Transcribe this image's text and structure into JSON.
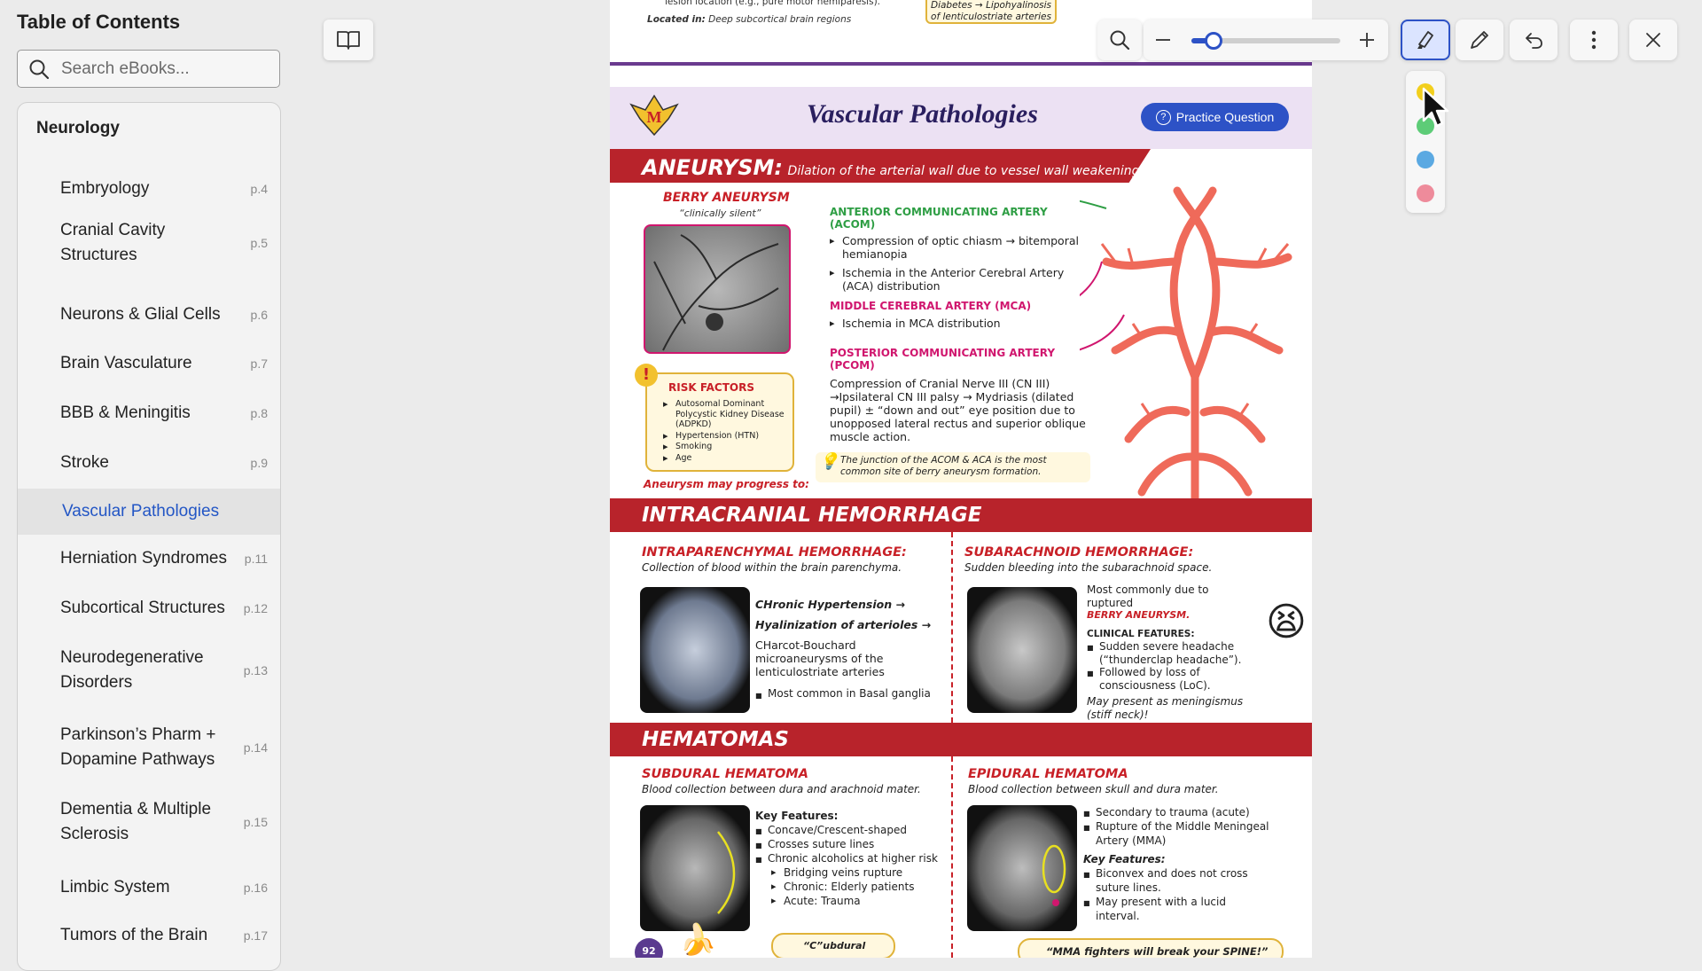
{
  "sidebar": {
    "title": "Table of Contents",
    "search_placeholder": "Search eBooks...",
    "section": "Neurology",
    "items": [
      {
        "label": "Embryology",
        "page": "p.4"
      },
      {
        "label": "Cranial Cavity Structures",
        "page": "p.5"
      },
      {
        "label": "Neurons & Glial Cells",
        "page": "p.6"
      },
      {
        "label": "Brain Vasculature",
        "page": "p.7"
      },
      {
        "label": "BBB & Meningitis",
        "page": "p.8"
      },
      {
        "label": "Stroke",
        "page": "p.9"
      },
      {
        "label": "Vascular Pathologies",
        "page": ""
      },
      {
        "label": "Herniation Syndromes",
        "page": "p.11"
      },
      {
        "label": "Subcortical Structures",
        "page": "p.12"
      },
      {
        "label": "Neurodegenerative Disorders",
        "page": "p.13"
      },
      {
        "label": "Parkinson’s Pharm + Dopamine Pathways",
        "page": "p.14"
      },
      {
        "label": "Dementia & Multiple Sclerosis",
        "page": "p.15"
      },
      {
        "label": "Limbic System",
        "page": "p.16"
      },
      {
        "label": "Tumors of the Brain",
        "page": "p.17"
      }
    ]
  },
  "toolbar": {
    "icons": [
      "search-icon",
      "zoom-out-icon",
      "zoom-slider",
      "zoom-in-icon",
      "highlighter-icon",
      "pencil-icon",
      "undo-icon",
      "more-icon",
      "close-icon"
    ],
    "zoom_level": 0.15,
    "highlight_colors": [
      "#f2cf1d",
      "#5dcc77",
      "#5ba9e2",
      "#ee8b9b"
    ]
  },
  "document": {
    "top_partial": "lesion location (e.g., pure motor hemiparesis).",
    "located_in_label": "Located in:",
    "located_in_text": "Deep subcortical brain regions",
    "top_box_line1": "Diabetes → Lipohyalinosis",
    "top_box_line2": "of lenticulostriate arteries",
    "title": "Vascular Pathologies",
    "practice_label": "Practice Question",
    "aneurysm": {
      "heading": "ANEURYSM:",
      "definition": "Dilation of the arterial wall due to vessel wall weakening.",
      "berry_title": "BERRY ANEURYSM",
      "berry_sub": "“clinically silent”",
      "acom_title": "ANTERIOR COMMUNICATING ARTERY (ACOM)",
      "acom_1": "Compression of optic chiasm → bitemporal hemianopia",
      "acom_2": "Ischemia in the Anterior Cerebral Artery (ACA) distribution",
      "mca_title": "MIDDLE CEREBRAL ARTERY (MCA)",
      "mca_1": "Ischemia in MCA distribution",
      "pcom_title": "POSTERIOR COMMUNICATING ARTERY (PCOM)",
      "pcom_text": "Compression of Cranial Nerve III (CN III) →Ipsilateral CN III palsy → Mydriasis (dilated pupil) ± “down and out” eye position due to unopposed lateral rectus and superior oblique muscle action.",
      "risk_title": "RISK FACTORS",
      "risk_items": [
        "Autosomal Dominant Polycystic Kidney Disease (ADPKD)",
        "Hypertension (HTN)",
        "Smoking",
        "Age"
      ],
      "tip": "The junction of the ACOM & ACA is the most common site of berry aneurysm formation.",
      "progress": "Aneurysm may progress to:"
    },
    "ich": {
      "heading": "INTRACRANIAL HEMORRHAGE",
      "iph_title": "INTRAPARENCHYMAL HEMORRHAGE:",
      "iph_sub": "Collection of blood within the brain parenchyma.",
      "iph_1": "CHronic Hypertension →",
      "iph_2": "Hyalinization of arterioles →",
      "iph_3": "CHarcot-Bouchard microaneurysms of the lenticulostriate arteries",
      "iph_4": "Most common in Basal ganglia",
      "sah_title": "SUBARACHNOID HEMORRHAGE:",
      "sah_sub": "Sudden bleeding into the subarachnoid space.",
      "sah_1": "Most commonly due to ruptured",
      "sah_2": "BERRY ANEURYSM.",
      "sah_cf": "CLINICAL FEATURES:",
      "sah_b1": "Sudden severe headache (“thunderclap headache”).",
      "sah_b2": "Followed by loss of consciousness (LoC).",
      "sah_note": "May present as meningismus (stiff neck)!"
    },
    "hematomas": {
      "heading": "HEMATOMAS",
      "sdh_title": "SUBDURAL HEMATOMA",
      "sdh_sub": "Blood collection between dura and arachnoid mater.",
      "sdh_kf": "Key Features:",
      "sdh_1": "Concave/Crescent-shaped",
      "sdh_2": "Crosses suture lines",
      "sdh_3": "Chronic alcoholics at higher risk",
      "sdh_4": "Bridging veins rupture",
      "sdh_5": "Chronic: Elderly patients",
      "sdh_6": "Acute: Trauma",
      "sdh_tip": "“C”ubdural",
      "edh_title": "EPIDURAL HEMATOMA",
      "edh_sub": "Blood collection between skull and dura mater.",
      "edh_1": "Secondary to trauma (acute)",
      "edh_2": "Rupture of the Middle Meningeal Artery (MMA)",
      "edh_kf": "Key Features:",
      "edh_3": "Biconvex and does not cross suture lines.",
      "edh_4": "May present with a lucid interval.",
      "edh_tip": "“MMA fighters will break your SPINE!”",
      "page_number": "92"
    }
  }
}
